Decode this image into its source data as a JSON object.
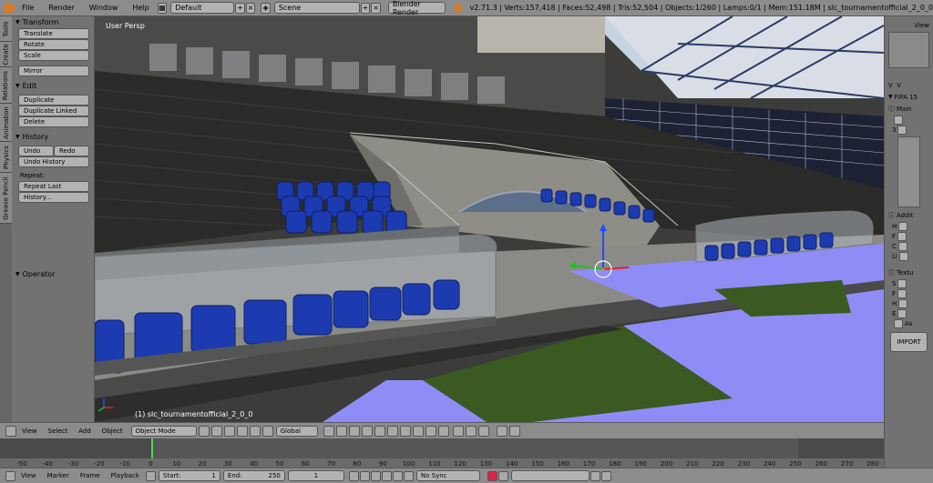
{
  "topbar": {
    "menus": [
      "File",
      "Render",
      "Window",
      "Help"
    ],
    "layout": "Default",
    "scene": "Scene",
    "engine": "Blender Render",
    "stats": "v2.71.3 | Verts:157,418 | Faces:52,498 | Tris:52,504 | Objects:1/260 | Lamps:0/1 | Mem:151.18M | slc_tournamentofficial_2_0_0"
  },
  "lefttabs": [
    "Tools",
    "Create",
    "Relations",
    "Animation",
    "Physics",
    "Grease Pencil"
  ],
  "toolshelf": {
    "transform": {
      "title": "Transform",
      "buttons": [
        "Translate",
        "Rotate",
        "Scale",
        "Mirror"
      ]
    },
    "edit": {
      "title": "Edit",
      "buttons": [
        "Duplicate",
        "Duplicate Linked",
        "Delete"
      ]
    },
    "history": {
      "title": "History",
      "undo": "Undo",
      "redo": "Redo",
      "undo_history": "Undo History",
      "repeat_label": "Repeat:",
      "repeat_last": "Repeat Last",
      "history_btn": "History..."
    },
    "operator": {
      "title": "Operator"
    }
  },
  "viewport": {
    "label": "User Persp",
    "object_label": "(1) slc_tournamentofficial_2_0_0"
  },
  "rightpanel": {
    "view": "View",
    "fifa": "FIFA 15",
    "main": "Main",
    "num": "3",
    "addit": "Addit",
    "addit_rows": [
      "H",
      "F",
      "C",
      "Li"
    ],
    "textu": "Textu",
    "textu_rows": [
      "S",
      "F",
      "H",
      "E"
    ],
    "as": "As",
    "import": "IMPORT"
  },
  "bar3d": {
    "menus": [
      "View",
      "Select",
      "Add",
      "Object"
    ],
    "mode": "Object Mode",
    "orientation": "Global"
  },
  "timeline": {
    "ticks": [
      "-50",
      "-40",
      "-30",
      "-20",
      "-10",
      "0",
      "10",
      "20",
      "30",
      "40",
      "50",
      "60",
      "70",
      "80",
      "90",
      "100",
      "110",
      "120",
      "130",
      "140",
      "150",
      "160",
      "170",
      "180",
      "190",
      "200",
      "210",
      "220",
      "230",
      "240",
      "250",
      "260",
      "270",
      "280"
    ]
  },
  "bottombar": {
    "menus": [
      "View",
      "Marker",
      "Frame",
      "Playback"
    ],
    "start_label": "Start:",
    "start_value": "1",
    "end_label": "End:",
    "end_value": "250",
    "current": "1",
    "sync": "No Sync"
  },
  "colors": {
    "accent_blue": "#1d3bb0",
    "floor_violet": "#8f8cf5",
    "grass": "#3a5a22"
  }
}
